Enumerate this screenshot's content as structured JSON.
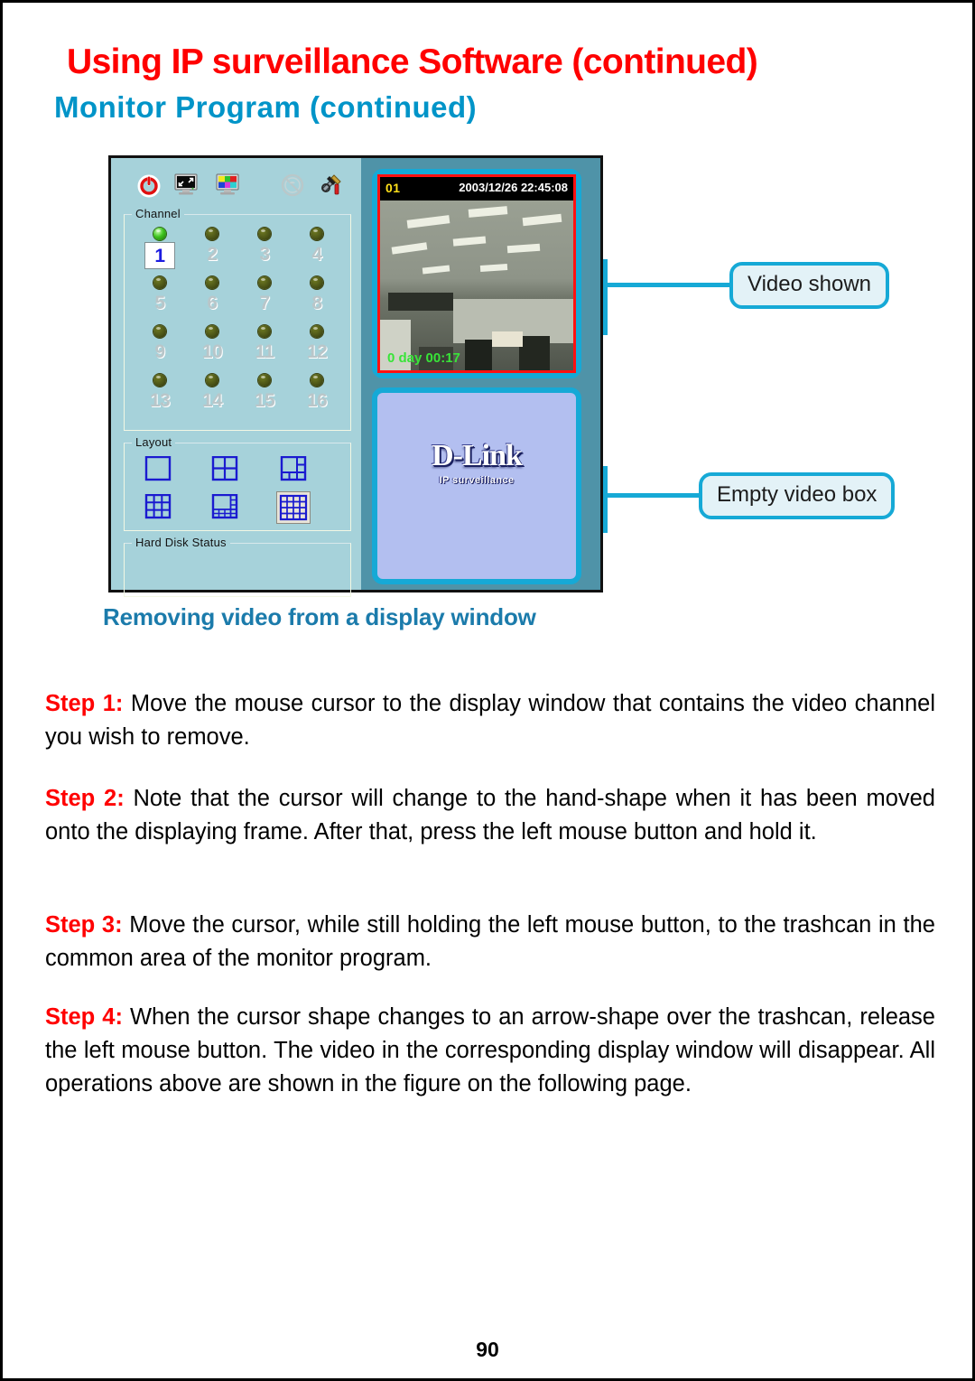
{
  "header": {
    "main_title": "Using IP surveillance Software (continued)",
    "sub_title": "Monitor  Program  (continued)",
    "title_color": "#ff0000",
    "subtitle_color": "#0094c8"
  },
  "figure": {
    "panel_bg_color": "#a6d2da",
    "video_region_bg_color": "#4f93a8",
    "frame_accent_color": "#16a9d6",
    "toolbar": {
      "icons": [
        {
          "name": "power-icon",
          "label": "Power"
        },
        {
          "name": "screen-resize-icon",
          "label": "Full screen"
        },
        {
          "name": "color-settings-icon",
          "label": "Color setting"
        },
        {
          "name": "disabled-icon",
          "label": "Disabled"
        },
        {
          "name": "tools-config-icon",
          "label": "Configuration"
        }
      ]
    },
    "channel_group": {
      "title": "Channel",
      "selected_channel": "1",
      "channels": [
        {
          "number": "1",
          "active": true
        },
        {
          "number": "2",
          "active": false
        },
        {
          "number": "3",
          "active": false
        },
        {
          "number": "4",
          "active": false
        },
        {
          "number": "5",
          "active": false
        },
        {
          "number": "6",
          "active": false
        },
        {
          "number": "7",
          "active": false
        },
        {
          "number": "8",
          "active": false
        },
        {
          "number": "9",
          "active": false
        },
        {
          "number": "10",
          "active": false
        },
        {
          "number": "11",
          "active": false
        },
        {
          "number": "12",
          "active": false
        },
        {
          "number": "13",
          "active": false
        },
        {
          "number": "14",
          "active": false
        },
        {
          "number": "15",
          "active": false
        },
        {
          "number": "16",
          "active": false
        }
      ]
    },
    "layout_group": {
      "title": "Layout",
      "selected_index": 5,
      "buttons": [
        {
          "name": "layout-1x1",
          "label": "1 window"
        },
        {
          "name": "layout-2x2",
          "label": "4 windows"
        },
        {
          "name": "layout-1plus3",
          "label": "1 large + 3"
        },
        {
          "name": "layout-3x3",
          "label": "9 windows"
        },
        {
          "name": "layout-1plus12",
          "label": "1 large + 12"
        },
        {
          "name": "layout-4x4",
          "label": "16 windows"
        }
      ]
    },
    "hdd_group": {
      "title": "Hard Disk Status"
    },
    "active_video": {
      "channel_label": "01",
      "timestamp": "2003/12/26 22:45:08",
      "duration": "0 day  00:17",
      "channel_label_color": "#ffe11a",
      "timestamp_color": "#ffffff",
      "duration_color": "#38e438",
      "border_color": "#ff1111"
    },
    "empty_video": {
      "logo_main": "D-Link",
      "logo_sub": "IP surveillance",
      "background_color": "#b3bff0"
    }
  },
  "callouts": [
    {
      "name": "callout-video-shown",
      "text": "Video shown"
    },
    {
      "name": "callout-empty-video-box",
      "text": "Empty video box"
    }
  ],
  "body": {
    "section_heading": "Removing video from a display window",
    "steps": [
      {
        "label": "Step 1:",
        "text": " Move the mouse cursor to the display window that contains the video channel you wish to remove."
      },
      {
        "label": "Step 2:",
        "text": " Note that the cursor will change to the hand-shape when it has been moved onto the displaying frame. After that, press the left mouse button and hold it."
      },
      {
        "label": "Step 3:",
        "text": " Move the cursor, while still holding the left mouse button, to the trashcan in the common area of the monitor program."
      },
      {
        "label": "Step 4:",
        "text": " When the cursor shape changes to an arrow-shape over the trashcan, release the left mouse button. The video in the corresponding display window will disappear. All operations above are shown in the figure on the following page."
      }
    ]
  },
  "footer": {
    "page_number": "90"
  }
}
